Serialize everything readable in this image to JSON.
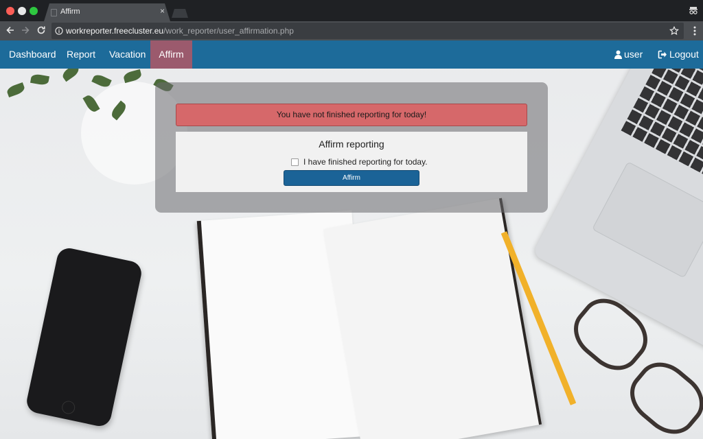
{
  "browser": {
    "tab_title": "Affirm",
    "tab_close": "×",
    "url_host": "workreporter.freecluster.eu",
    "url_path": "/work_reporter/user_affirmation.php"
  },
  "navbar": {
    "items": [
      {
        "label": "Dashboard"
      },
      {
        "label": "Report"
      },
      {
        "label": "Vacation"
      },
      {
        "label": "Affirm",
        "active": true
      }
    ],
    "user_label": "user",
    "logout_label": "Logout",
    "bar_color": "#1d6b9a",
    "active_color": "#9b5a6d"
  },
  "alert": {
    "message": "You have not finished reporting for today!",
    "color": "#d6686a"
  },
  "affirm_card": {
    "title": "Affirm reporting",
    "checkbox_label": "I have finished reporting for today.",
    "checkbox_checked": false,
    "button_label": "Affirm",
    "button_color": "#1b6397"
  }
}
